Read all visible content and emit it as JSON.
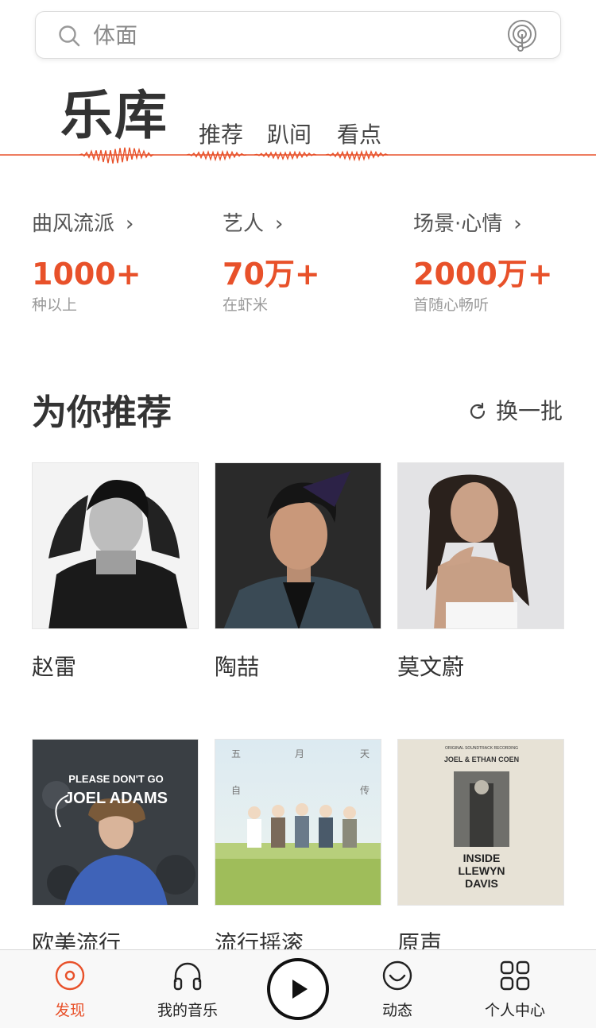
{
  "search": {
    "placeholder": "体面"
  },
  "header": {
    "title": "乐库",
    "tabs": [
      "推荐",
      "趴间",
      "看点"
    ],
    "accent_color": "#e8512a"
  },
  "stats": [
    {
      "label": "曲风流派",
      "value": "1000+",
      "sub": "种以上"
    },
    {
      "label": "艺人",
      "value": "70万+",
      "sub": "在虾米"
    },
    {
      "label": "场景·心情",
      "value": "2000万+",
      "sub": "首随心畅听"
    }
  ],
  "recommend": {
    "title": "为你推荐",
    "refresh_label": "换一批",
    "items": [
      {
        "name": "赵雷"
      },
      {
        "name": "陶喆"
      },
      {
        "name": "莫文蔚"
      },
      {
        "name": "欧美流行",
        "cover_text": [
          "PLEASE DON'T GO",
          "JOEL ADAMS"
        ]
      },
      {
        "name": "流行摇滚",
        "cover_text": [
          "五",
          "月",
          "天",
          "自",
          "传"
        ]
      },
      {
        "name": "原声",
        "cover_text": [
          "ORIGINAL SOUNDTRACK RECORDING",
          "JOEL & ETHAN COEN",
          "INSIDE",
          "LLEWYN",
          "DAVIS"
        ]
      }
    ]
  },
  "tabbar": {
    "items": [
      {
        "label": "发现",
        "icon": "disc-icon",
        "active": true
      },
      {
        "label": "我的音乐",
        "icon": "headphones-icon"
      },
      {
        "label": "play",
        "icon": "play-icon"
      },
      {
        "label": "动态",
        "icon": "smile-icon"
      },
      {
        "label": "个人中心",
        "icon": "grid-icon"
      }
    ]
  }
}
